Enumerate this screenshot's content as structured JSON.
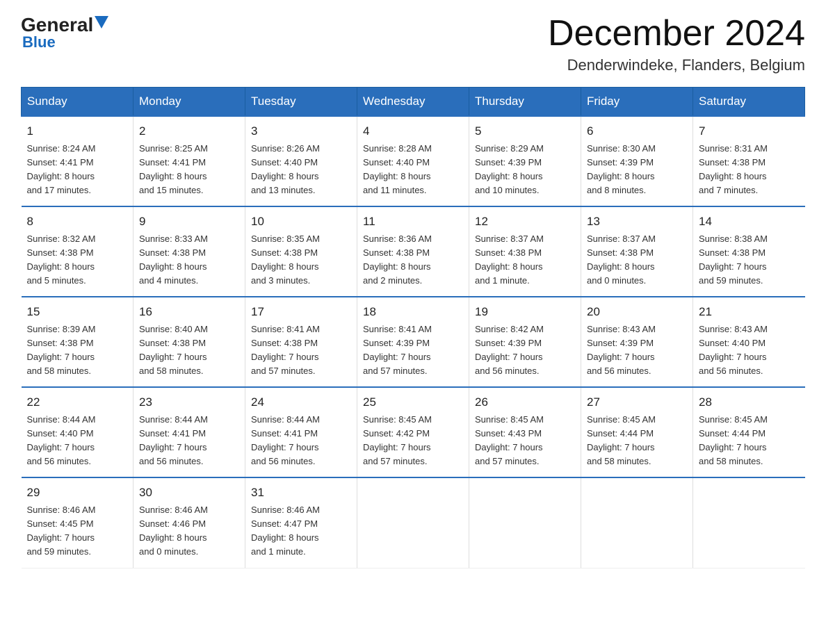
{
  "header": {
    "logo_general": "General",
    "logo_blue": "Blue",
    "title": "December 2024",
    "subtitle": "Denderwindeke, Flanders, Belgium"
  },
  "days_of_week": [
    "Sunday",
    "Monday",
    "Tuesday",
    "Wednesday",
    "Thursday",
    "Friday",
    "Saturday"
  ],
  "weeks": [
    [
      {
        "day": "1",
        "info": "Sunrise: 8:24 AM\nSunset: 4:41 PM\nDaylight: 8 hours\nand 17 minutes."
      },
      {
        "day": "2",
        "info": "Sunrise: 8:25 AM\nSunset: 4:41 PM\nDaylight: 8 hours\nand 15 minutes."
      },
      {
        "day": "3",
        "info": "Sunrise: 8:26 AM\nSunset: 4:40 PM\nDaylight: 8 hours\nand 13 minutes."
      },
      {
        "day": "4",
        "info": "Sunrise: 8:28 AM\nSunset: 4:40 PM\nDaylight: 8 hours\nand 11 minutes."
      },
      {
        "day": "5",
        "info": "Sunrise: 8:29 AM\nSunset: 4:39 PM\nDaylight: 8 hours\nand 10 minutes."
      },
      {
        "day": "6",
        "info": "Sunrise: 8:30 AM\nSunset: 4:39 PM\nDaylight: 8 hours\nand 8 minutes."
      },
      {
        "day": "7",
        "info": "Sunrise: 8:31 AM\nSunset: 4:38 PM\nDaylight: 8 hours\nand 7 minutes."
      }
    ],
    [
      {
        "day": "8",
        "info": "Sunrise: 8:32 AM\nSunset: 4:38 PM\nDaylight: 8 hours\nand 5 minutes."
      },
      {
        "day": "9",
        "info": "Sunrise: 8:33 AM\nSunset: 4:38 PM\nDaylight: 8 hours\nand 4 minutes."
      },
      {
        "day": "10",
        "info": "Sunrise: 8:35 AM\nSunset: 4:38 PM\nDaylight: 8 hours\nand 3 minutes."
      },
      {
        "day": "11",
        "info": "Sunrise: 8:36 AM\nSunset: 4:38 PM\nDaylight: 8 hours\nand 2 minutes."
      },
      {
        "day": "12",
        "info": "Sunrise: 8:37 AM\nSunset: 4:38 PM\nDaylight: 8 hours\nand 1 minute."
      },
      {
        "day": "13",
        "info": "Sunrise: 8:37 AM\nSunset: 4:38 PM\nDaylight: 8 hours\nand 0 minutes."
      },
      {
        "day": "14",
        "info": "Sunrise: 8:38 AM\nSunset: 4:38 PM\nDaylight: 7 hours\nand 59 minutes."
      }
    ],
    [
      {
        "day": "15",
        "info": "Sunrise: 8:39 AM\nSunset: 4:38 PM\nDaylight: 7 hours\nand 58 minutes."
      },
      {
        "day": "16",
        "info": "Sunrise: 8:40 AM\nSunset: 4:38 PM\nDaylight: 7 hours\nand 58 minutes."
      },
      {
        "day": "17",
        "info": "Sunrise: 8:41 AM\nSunset: 4:38 PM\nDaylight: 7 hours\nand 57 minutes."
      },
      {
        "day": "18",
        "info": "Sunrise: 8:41 AM\nSunset: 4:39 PM\nDaylight: 7 hours\nand 57 minutes."
      },
      {
        "day": "19",
        "info": "Sunrise: 8:42 AM\nSunset: 4:39 PM\nDaylight: 7 hours\nand 56 minutes."
      },
      {
        "day": "20",
        "info": "Sunrise: 8:43 AM\nSunset: 4:39 PM\nDaylight: 7 hours\nand 56 minutes."
      },
      {
        "day": "21",
        "info": "Sunrise: 8:43 AM\nSunset: 4:40 PM\nDaylight: 7 hours\nand 56 minutes."
      }
    ],
    [
      {
        "day": "22",
        "info": "Sunrise: 8:44 AM\nSunset: 4:40 PM\nDaylight: 7 hours\nand 56 minutes."
      },
      {
        "day": "23",
        "info": "Sunrise: 8:44 AM\nSunset: 4:41 PM\nDaylight: 7 hours\nand 56 minutes."
      },
      {
        "day": "24",
        "info": "Sunrise: 8:44 AM\nSunset: 4:41 PM\nDaylight: 7 hours\nand 56 minutes."
      },
      {
        "day": "25",
        "info": "Sunrise: 8:45 AM\nSunset: 4:42 PM\nDaylight: 7 hours\nand 57 minutes."
      },
      {
        "day": "26",
        "info": "Sunrise: 8:45 AM\nSunset: 4:43 PM\nDaylight: 7 hours\nand 57 minutes."
      },
      {
        "day": "27",
        "info": "Sunrise: 8:45 AM\nSunset: 4:44 PM\nDaylight: 7 hours\nand 58 minutes."
      },
      {
        "day": "28",
        "info": "Sunrise: 8:45 AM\nSunset: 4:44 PM\nDaylight: 7 hours\nand 58 minutes."
      }
    ],
    [
      {
        "day": "29",
        "info": "Sunrise: 8:46 AM\nSunset: 4:45 PM\nDaylight: 7 hours\nand 59 minutes."
      },
      {
        "day": "30",
        "info": "Sunrise: 8:46 AM\nSunset: 4:46 PM\nDaylight: 8 hours\nand 0 minutes."
      },
      {
        "day": "31",
        "info": "Sunrise: 8:46 AM\nSunset: 4:47 PM\nDaylight: 8 hours\nand 1 minute."
      },
      {
        "day": "",
        "info": ""
      },
      {
        "day": "",
        "info": ""
      },
      {
        "day": "",
        "info": ""
      },
      {
        "day": "",
        "info": ""
      }
    ]
  ]
}
